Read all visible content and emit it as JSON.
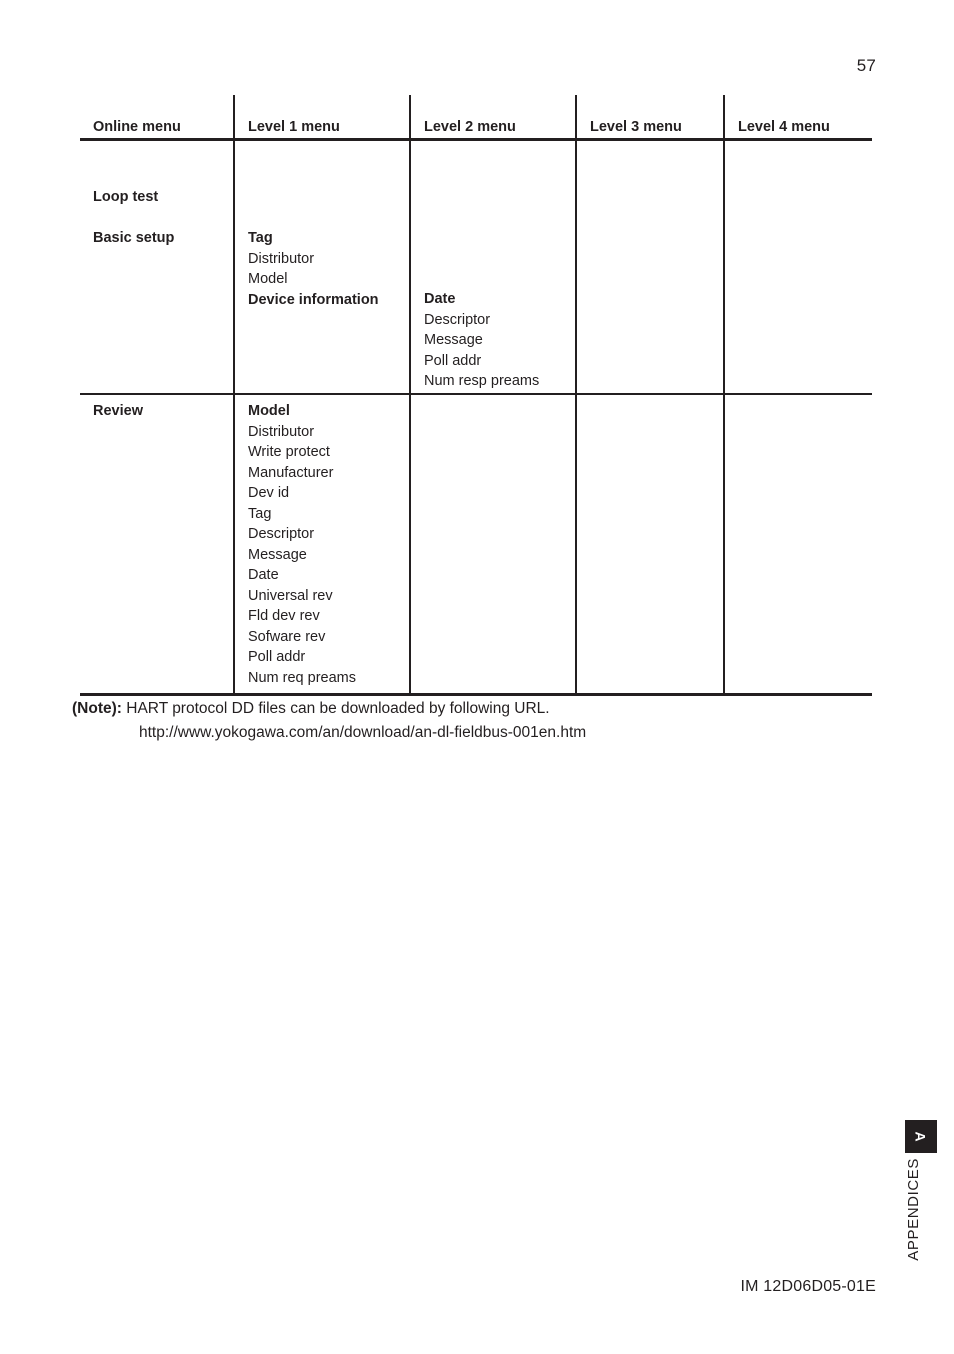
{
  "page": {
    "number": "57",
    "footer_document_id": "IM 12D06D05-01E"
  },
  "side_tab": {
    "letter": "A",
    "label": "APPENDICES"
  },
  "table": {
    "columns": [
      {
        "header": "Online menu"
      },
      {
        "header": "Level 1 menu"
      },
      {
        "header": "Level 2 menu"
      },
      {
        "header": "Level 3 menu"
      },
      {
        "header": "Level 4 menu"
      }
    ],
    "rows": [
      {
        "online_menu": [
          "Loop test",
          "Basic setup"
        ],
        "level1": {
          "lines": [
            {
              "text": "Tag",
              "bold": true
            },
            {
              "text": "Distributor",
              "bold": false
            },
            {
              "text": "Model",
              "bold": false
            },
            {
              "text": "Device information",
              "bold": true
            }
          ]
        },
        "level2": {
          "lines": [
            {
              "text": "Date",
              "bold": true
            },
            {
              "text": "Descriptor",
              "bold": false
            },
            {
              "text": "Message",
              "bold": false
            },
            {
              "text": "Poll addr",
              "bold": false
            },
            {
              "text": "Num resp preams",
              "bold": false
            }
          ]
        },
        "level3": {
          "lines": []
        },
        "level4": {
          "lines": []
        }
      },
      {
        "online_menu": [
          "Review"
        ],
        "level1": {
          "lines": [
            {
              "text": "Model",
              "bold": true
            },
            {
              "text": "Distributor",
              "bold": false
            },
            {
              "text": "Write protect",
              "bold": false
            },
            {
              "text": "Manufacturer",
              "bold": false
            },
            {
              "text": "Dev id",
              "bold": false
            },
            {
              "text": "Tag",
              "bold": false
            },
            {
              "text": "Descriptor",
              "bold": false
            },
            {
              "text": "Message",
              "bold": false
            },
            {
              "text": "Date",
              "bold": false
            },
            {
              "text": "Universal rev",
              "bold": false
            },
            {
              "text": "Fld dev rev",
              "bold": false
            },
            {
              "text": "Sofware rev",
              "bold": false
            },
            {
              "text": "Poll addr",
              "bold": false
            },
            {
              "text": "Num req preams",
              "bold": false
            }
          ]
        },
        "level2": {
          "lines": []
        },
        "level3": {
          "lines": []
        },
        "level4": {
          "lines": []
        }
      }
    ]
  },
  "note": {
    "label": "(Note):",
    "text": "HART protocol DD files can be downloaded by following URL.",
    "url": "http://www.yokogawa.com/an/download/an-dl-fieldbus-001en.htm"
  }
}
